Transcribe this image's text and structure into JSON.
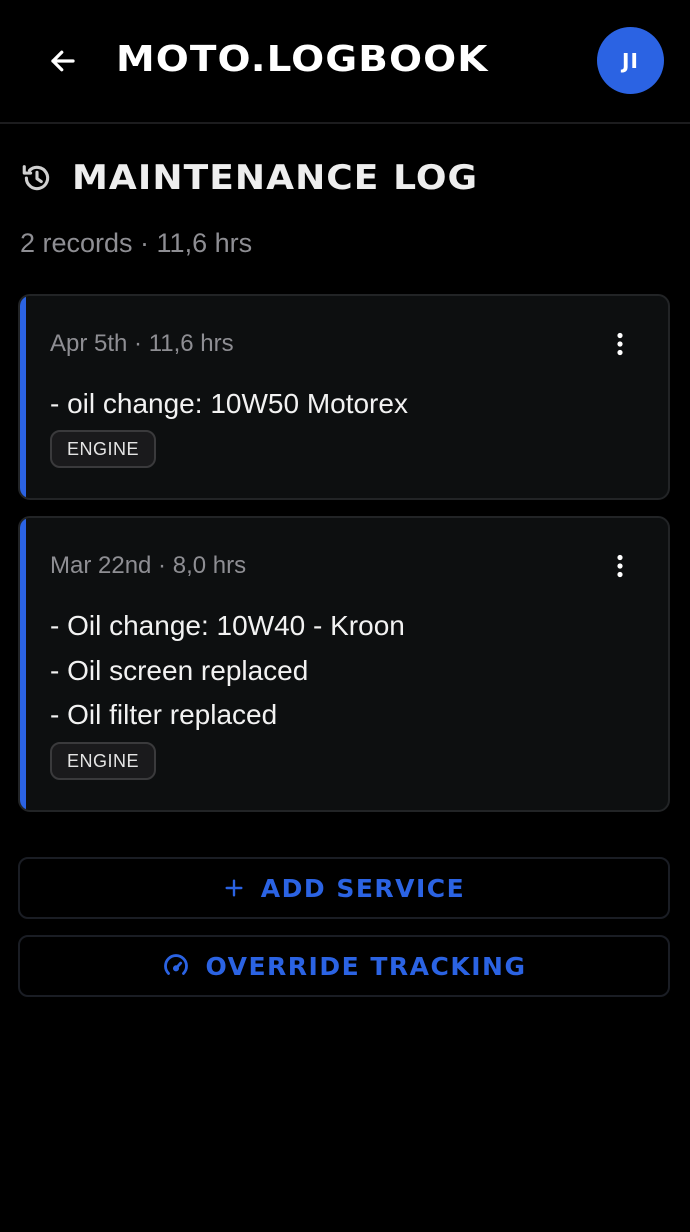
{
  "header": {
    "title": "MOTO.LOGBOOK",
    "avatar_initials": "JI"
  },
  "section": {
    "title": "MAINTENANCE LOG",
    "summary": "2 records · 11,6 hrs"
  },
  "records": [
    {
      "meta": "Apr 5th · 11,6 hrs",
      "notes": [
        "- oil change: 10W50 Motorex"
      ],
      "tag": "ENGINE"
    },
    {
      "meta": "Mar 22nd · 8,0 hrs",
      "notes": [
        "- Oil change: 10W40 - Kroon",
        "- Oil screen replaced",
        "- Oil filter replaced"
      ],
      "tag": "ENGINE"
    }
  ],
  "actions": {
    "add_service": "ADD SERVICE",
    "override_tracking": "OVERRIDE TRACKING"
  },
  "colors": {
    "accent": "#2b63e3",
    "background": "#000000",
    "card": "#0d0f10",
    "muted_text": "#8e8e93"
  },
  "icons": {
    "back": "arrow-left-icon",
    "section": "history-icon",
    "card_menu": "more-vertical-icon",
    "add": "plus-icon",
    "override": "speedometer-icon"
  }
}
